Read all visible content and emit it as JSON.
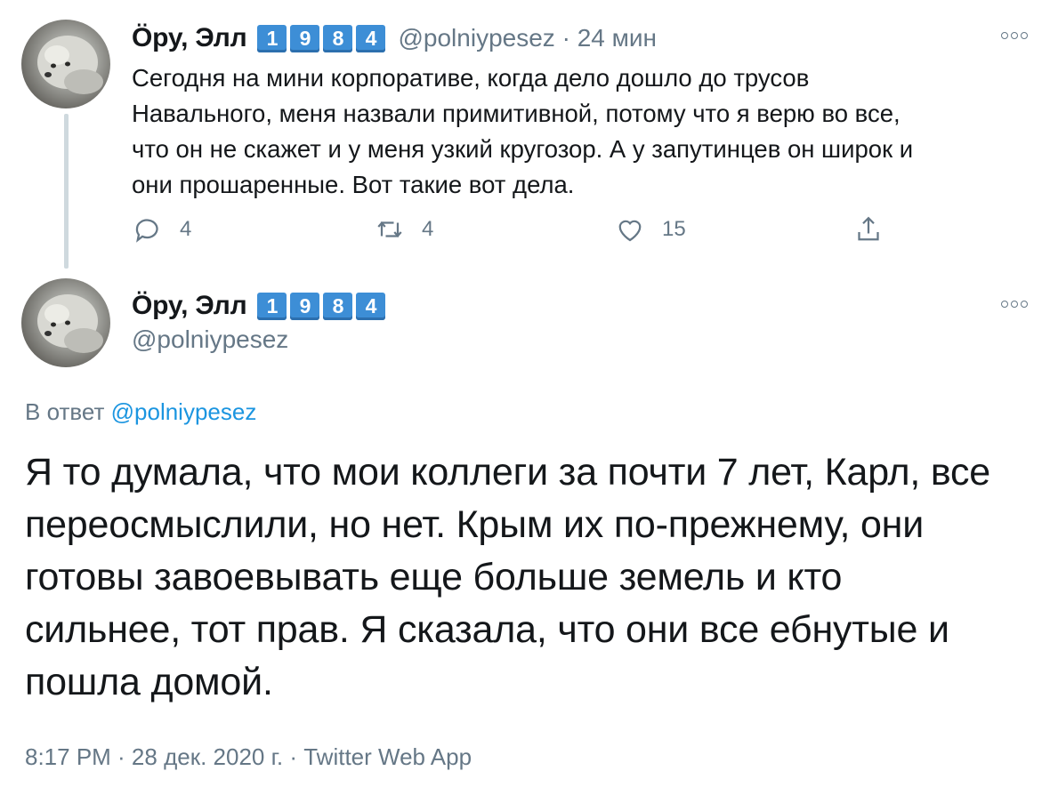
{
  "colors": {
    "text": "#14171a",
    "secondary": "#657786",
    "link": "#1b95e0",
    "badge": "#3d8ed6",
    "thread_line": "#cfd9de"
  },
  "tweet1": {
    "name": "Öру, Элл",
    "badges": [
      "1",
      "9",
      "8",
      "4"
    ],
    "handle": "@polniypesez",
    "separator": "·",
    "time": "24 мин",
    "text_lines": [
      "Сегодня на мини корпоративе, когда дело дошло до трусов",
      "Навального, меня назвали примитивной, потому что я верю во все,",
      "что он не скажет и у меня узкий кругозор. А у запутинцев он широк и",
      "они прошаренные. Вот такие вот дела."
    ],
    "actions": {
      "reply_icon": "reply-icon",
      "reply_count": "4",
      "retweet_icon": "retweet-icon",
      "retweet_count": "4",
      "like_icon": "heart-icon",
      "like_count": "15",
      "share_icon": "share-icon"
    }
  },
  "tweet2": {
    "name": "Öру, Элл",
    "badges": [
      "1",
      "9",
      "8",
      "4"
    ],
    "handle": "@polniypesez",
    "reply_label": "В ответ",
    "reply_mention": "@polniypesez",
    "text_lines": [
      "Я то думала, что мои коллеги за почти 7 лет, Карл, все",
      "переосмыслили, но нет. Крым их по-прежнему, они",
      "готовы завоевывать еще больше земель и кто",
      "сильнее, тот прав. Я сказала, что они все ебнутые и",
      "пошла домой."
    ],
    "meta": "8:17 PM · 28 дек. 2020 г. · Twitter Web App"
  }
}
